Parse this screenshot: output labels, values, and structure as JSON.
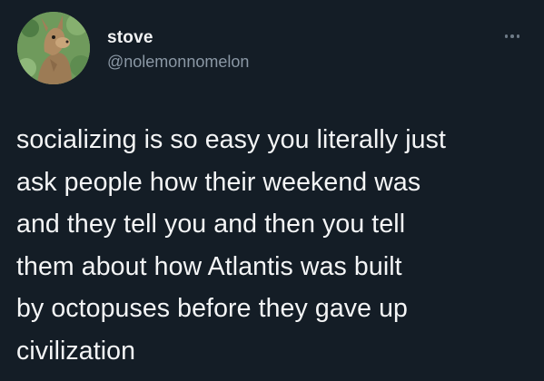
{
  "author": {
    "display_name": "stove",
    "handle": "@nolemonnomelon",
    "avatar_icon": "kangaroo-avatar-icon"
  },
  "more_options_icon": "more-dots-icon",
  "tweet": {
    "text": "socializing is so easy you literally just\nask people how their weekend was\nand they tell you and then you tell\nthem about how Atlantis was built\nby octopuses before they gave up\ncivilization"
  },
  "colors": {
    "background": "#141d26",
    "text": "#f4f5f6",
    "handle": "#8b98a5"
  }
}
